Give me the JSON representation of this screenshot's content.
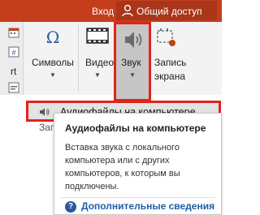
{
  "titlebar": {
    "signin_label": "Вход",
    "share_label": "Общий доступ",
    "icon": "person-icon",
    "background": "#c43e1c"
  },
  "ribbon": {
    "items": [
      {
        "label": "Символы",
        "icon": "omega-icon"
      },
      {
        "label": "Видео",
        "icon": "film-icon"
      },
      {
        "label": "Звук",
        "icon": "speaker-icon",
        "selected": true
      },
      {
        "label": "Запись\nэкрана",
        "icon": "screen-record-icon"
      }
    ],
    "left_partial_label": "rt"
  },
  "dropdown": {
    "items": [
      {
        "label": "Аудиофайлы на компьютере...",
        "icon": "speaker-small-icon",
        "highlighted": true
      },
      {
        "label": "Записать звук..."
      }
    ]
  },
  "tooltip": {
    "title": "Аудиофайлы на компьютере",
    "body": "Вставка звука с локального компьютера или с других компьютеров, к которым вы подключены.",
    "more_label": "Дополнительные сведения",
    "help_icon": "question-icon"
  },
  "colors": {
    "accent": "#c43e1c",
    "highlight_border": "#e2231a",
    "link": "#1f5ea8"
  }
}
